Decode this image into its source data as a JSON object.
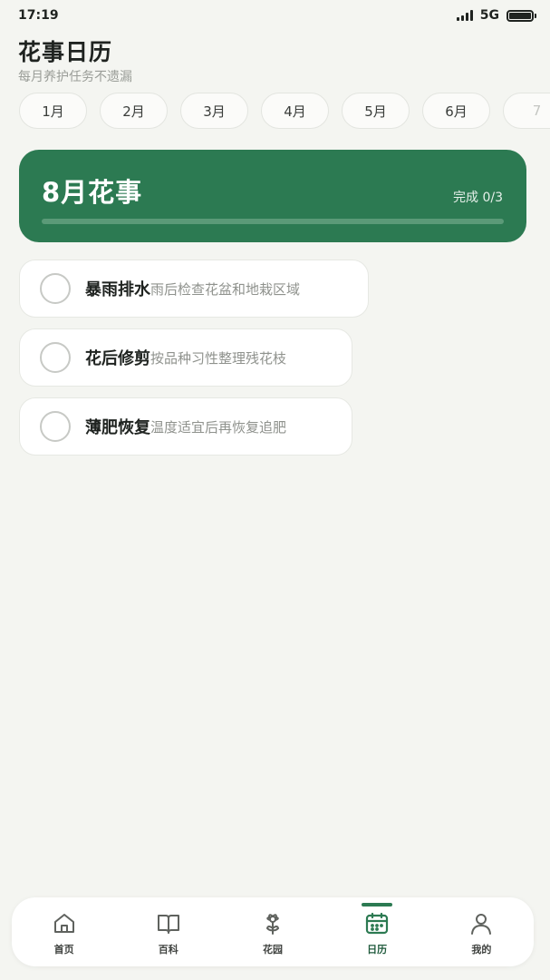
{
  "status_bar": {
    "time": "17:19",
    "network": "5G"
  },
  "header": {
    "title": "花事日历",
    "subtitle": "每月养护任务不遗漏"
  },
  "months": [
    "1月",
    "2月",
    "3月",
    "4月",
    "5月",
    "6月",
    "7"
  ],
  "selected_month_card": {
    "title": "8月花事",
    "progress_label": "完成 0/3",
    "completed": 0,
    "total": 3
  },
  "tasks": [
    {
      "name": "暴雨排水",
      "desc": "雨后检查花盆和地栽区域",
      "done": false
    },
    {
      "name": "花后修剪",
      "desc": "按品种习性整理残花枝",
      "done": false
    },
    {
      "name": "薄肥恢复",
      "desc": "温度适宜后再恢复追肥",
      "done": false
    }
  ],
  "tab_bar": {
    "items": [
      {
        "label": "首页",
        "icon": "home-icon"
      },
      {
        "label": "百科",
        "icon": "book-icon"
      },
      {
        "label": "花园",
        "icon": "flower-icon"
      },
      {
        "label": "日历",
        "icon": "calendar-icon",
        "active": true
      },
      {
        "label": "我的",
        "icon": "user-icon"
      }
    ]
  },
  "colors": {
    "accent": "#2c7a52",
    "background": "#f4f5f1"
  }
}
